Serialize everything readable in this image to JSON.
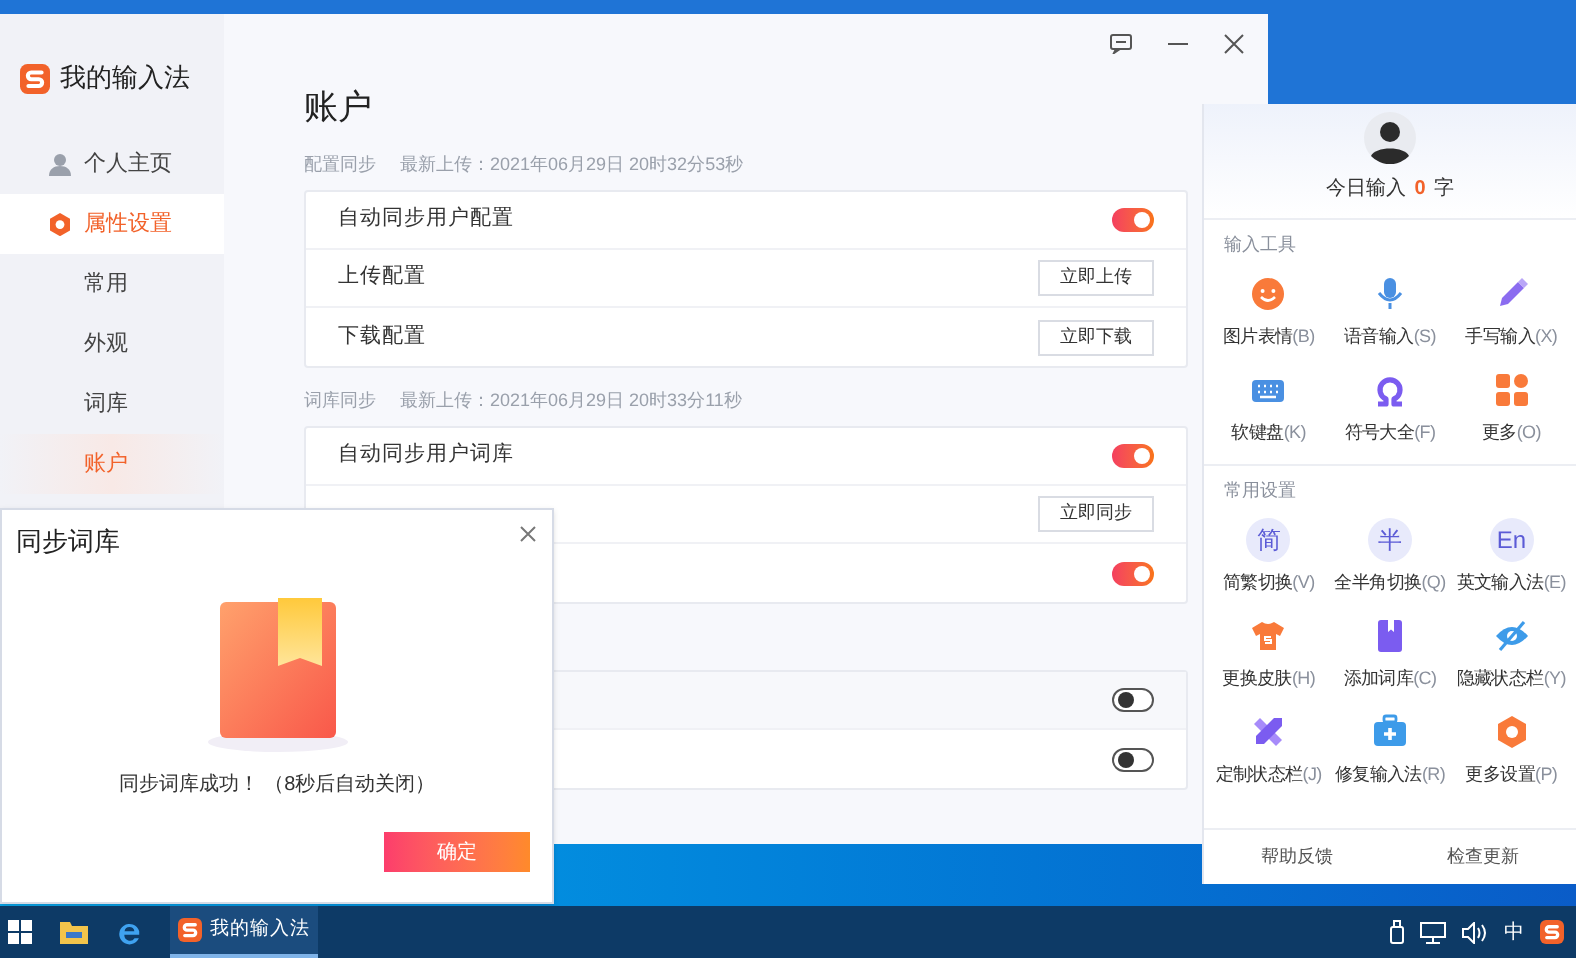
{
  "main_window": {
    "app_name": "我的输入法",
    "sidebar": [
      {
        "label": "个人主页",
        "kind": "person",
        "expanded": false
      },
      {
        "label": "属性设置",
        "kind": "gear",
        "expanded": true,
        "children": [
          {
            "label": "常用",
            "selected": false
          },
          {
            "label": "外观",
            "selected": false
          },
          {
            "label": "词库",
            "selected": false
          },
          {
            "label": "账户",
            "selected": true
          }
        ]
      }
    ],
    "page_title": "账户",
    "sections": [
      {
        "label": "配置同步",
        "meta": "最新上传：2021年06月29日 20时32分53秒",
        "rows": [
          {
            "kind": "toggle",
            "label": "自动同步用户配置",
            "on": true
          },
          {
            "kind": "button",
            "label": "上传配置",
            "button": "立即上传"
          },
          {
            "kind": "button",
            "label": "下载配置",
            "button": "立即下载"
          }
        ]
      },
      {
        "label": "词库同步",
        "meta": "最新上传：2021年06月29日 20时33分11秒",
        "rows": [
          {
            "kind": "toggle",
            "label": "自动同步用户词库",
            "on": true
          },
          {
            "kind": "button",
            "button": "立即同步"
          },
          {
            "kind": "toggle",
            "on": true
          }
        ]
      },
      {
        "rows": [
          {
            "kind": "toggle",
            "on": false
          },
          {
            "kind": "toggle",
            "on": false
          }
        ]
      }
    ]
  },
  "dialog": {
    "title": "同步词库",
    "message": "同步词库成功！ （8秒后自动关闭）",
    "button": "确定"
  },
  "quick_panel": {
    "today_label": "今日输入",
    "today_count": "0",
    "today_unit": "字",
    "groups": [
      {
        "title": "输入工具",
        "items": [
          {
            "kind": "smile",
            "label": "图片表情",
            "shortcut": "(B)"
          },
          {
            "kind": "mic",
            "label": "语音输入",
            "shortcut": "(S)"
          },
          {
            "kind": "pen",
            "label": "手写输入",
            "shortcut": "(X)"
          },
          {
            "kind": "keyboard",
            "label": "软键盘",
            "shortcut": "(K)"
          },
          {
            "kind": "omega",
            "label": "符号大全",
            "shortcut": "(F)"
          },
          {
            "kind": "tiles",
            "label": "更多",
            "shortcut": "(O)"
          }
        ]
      },
      {
        "title": "常用设置",
        "items": [
          {
            "kind": "glyph",
            "glyph": "简",
            "label": "简繁切换",
            "shortcut": "(V)"
          },
          {
            "kind": "glyph",
            "glyph": "半",
            "label": "全半角切换",
            "shortcut": "(Q)"
          },
          {
            "kind": "glyph",
            "glyph": "En",
            "label": "英文输入法",
            "shortcut": "(E)"
          },
          {
            "kind": "shirt",
            "label": "更换皮肤",
            "shortcut": "(H)"
          },
          {
            "kind": "book",
            "label": "添加词库",
            "shortcut": "(C)"
          },
          {
            "kind": "eye",
            "label": "隐藏状态栏",
            "shortcut": "(Y)"
          },
          {
            "kind": "tools",
            "label": "定制状态栏",
            "shortcut": "(J)"
          },
          {
            "kind": "medkit",
            "label": "修复输入法",
            "shortcut": "(R)"
          },
          {
            "kind": "hexagon",
            "label": "更多设置",
            "shortcut": "(P)"
          }
        ]
      }
    ],
    "footer": [
      "帮助反馈",
      "检查更新"
    ]
  },
  "taskbar": {
    "apps": [
      {
        "label": "我的输入法",
        "selected": true
      }
    ],
    "ime": "中"
  }
}
